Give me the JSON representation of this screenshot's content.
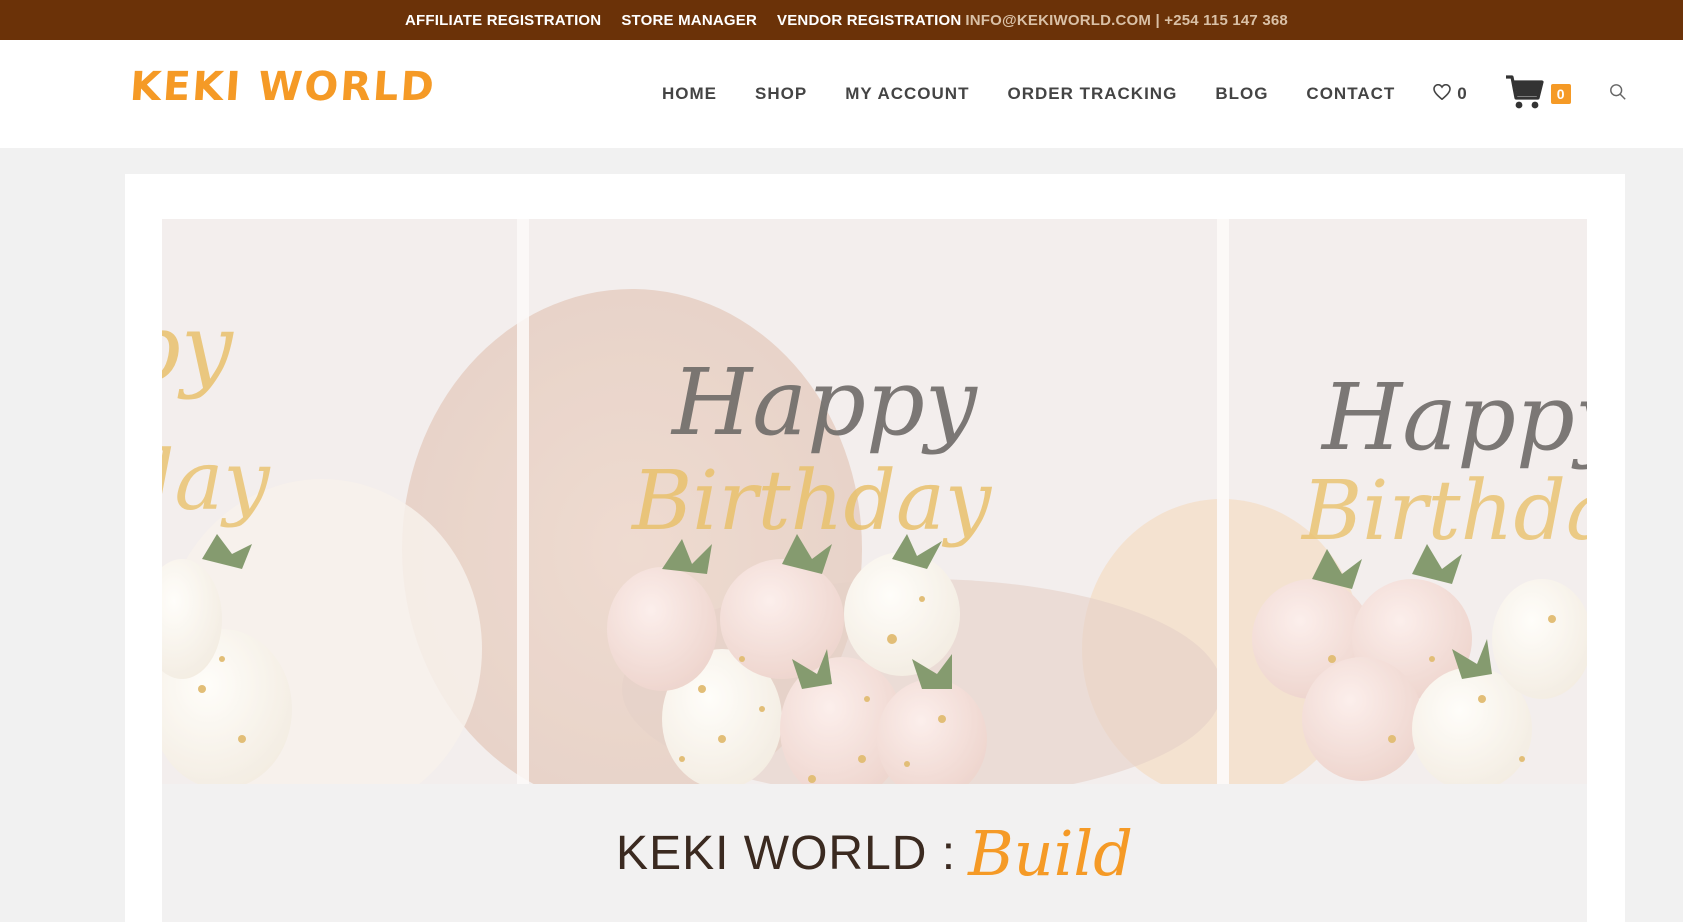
{
  "topbar": {
    "affiliate": "AFFILIATE REGISTRATION",
    "store_manager": "STORE MANAGER",
    "vendor": "VENDOR REGISTRATION",
    "contact": "INFO@KEKIWORLD.COM | +254 115 147 368"
  },
  "header": {
    "logo": "KEKI WORLD",
    "nav": [
      "HOME",
      "SHOP",
      "MY ACCOUNT",
      "ORDER TRACKING",
      "BLOG",
      "CONTACT"
    ],
    "wishlist_count": "0",
    "cart_count": "0"
  },
  "hero": {
    "topper_text": "Happy Birthday"
  },
  "page": {
    "title": "KEKI WORLD :",
    "title_accent": "Build"
  },
  "colors": {
    "topbar": "#6b3208",
    "accent": "#f59a26",
    "text": "#444444"
  }
}
